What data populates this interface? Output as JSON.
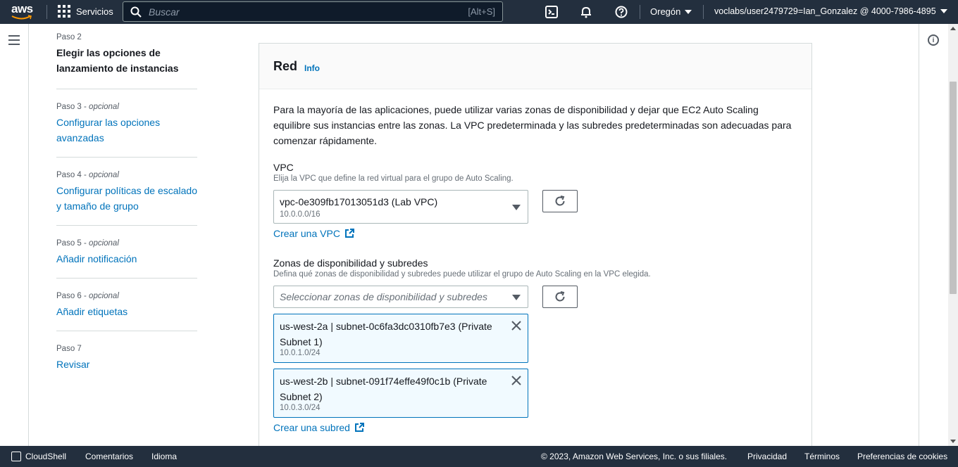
{
  "topnav": {
    "logo_text": "aws",
    "services_label": "Servicios",
    "search_placeholder": "Buscar",
    "search_shortcut": "[Alt+S]",
    "region": "Oregón",
    "account": "voclabs/user2479729=Ian_Gonzalez @ 4000-7986-4895"
  },
  "steps": [
    {
      "label": "Paso 2",
      "optional": "",
      "title": "Elegir las opciones de lanzamiento de instancias",
      "active": true
    },
    {
      "label": "Paso 3",
      "optional": "opcional",
      "title": "Configurar las opciones avanzadas",
      "active": false
    },
    {
      "label": "Paso 4",
      "optional": "opcional",
      "title": "Configurar políticas de escalado y tamaño de grupo",
      "active": false
    },
    {
      "label": "Paso 5",
      "optional": "opcional",
      "title": "Añadir notificación",
      "active": false
    },
    {
      "label": "Paso 6",
      "optional": "opcional",
      "title": "Añadir etiquetas",
      "active": false
    },
    {
      "label": "Paso 7",
      "optional": "",
      "title": "Revisar",
      "active": false
    }
  ],
  "network": {
    "title": "Red",
    "info": "Info",
    "description": "Para la mayoría de las aplicaciones, puede utilizar varias zonas de disponibilidad y dejar que EC2 Auto Scaling equilibre sus instancias entre las zonas. La VPC predeterminada y las subredes predeterminadas son adecuadas para comenzar rápidamente.",
    "vpc": {
      "label": "VPC",
      "description": "Elija la VPC que define la red virtual para el grupo de Auto Scaling.",
      "selected": "vpc-0e309fb17013051d3 (Lab VPC)",
      "cidr": "10.0.0.0/16",
      "create_link": "Crear una VPC"
    },
    "subnets": {
      "label": "Zonas de disponibilidad y subredes",
      "description": "Defina qué zonas de disponibilidad y subredes puede utilizar el grupo de Auto Scaling en la VPC elegida.",
      "placeholder": "Seleccionar zonas de disponibilidad y subredes",
      "tokens": [
        {
          "name": "us-west-2a | subnet-0c6fa3dc0310fb7e3 (Private Subnet 1)",
          "cidr": "10.0.1.0/24"
        },
        {
          "name": "us-west-2b | subnet-091f74effe49f0c1b (Private Subnet 2)",
          "cidr": "10.0.3.0/24"
        }
      ],
      "create_link": "Crear una subred"
    }
  },
  "footer": {
    "cloudshell": "CloudShell",
    "feedback": "Comentarios",
    "language": "Idioma",
    "copyright": "© 2023, Amazon Web Services, Inc. o sus filiales.",
    "privacy": "Privacidad",
    "terms": "Términos",
    "cookies": "Preferencias de cookies"
  },
  "colors": {
    "nav_bg": "#232f3e",
    "link": "#0073bb",
    "token_border": "#0073bb",
    "token_bg": "#f1faff"
  }
}
